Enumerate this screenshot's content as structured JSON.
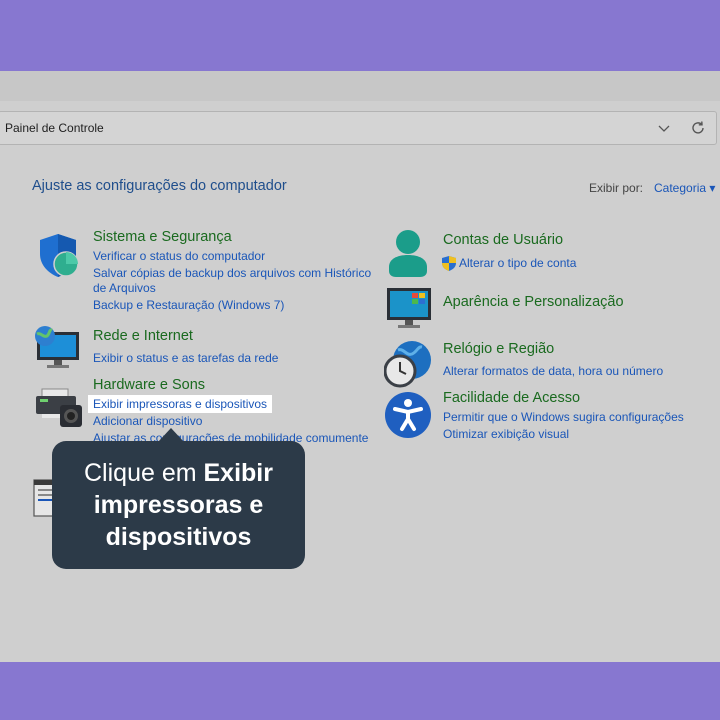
{
  "address": {
    "text": "Painel de Controle"
  },
  "heading": "Ajuste as configurações do computador",
  "view_by": {
    "label": "Exibir por:",
    "value": "Categoria"
  },
  "left_categories": [
    {
      "title": "Sistema e Segurança",
      "icon": "shield-icon",
      "links": [
        "Verificar o status do computador",
        "Salvar cópias de backup dos arquivos com Histórico",
        "de Arquivos",
        "Backup e Restauração (Windows 7)"
      ]
    },
    {
      "title": "Rede e Internet",
      "icon": "network-icon",
      "links": [
        "Exibir o status e as tarefas da rede"
      ]
    },
    {
      "title": "Hardware e Sons",
      "icon": "printer-icon",
      "links": [
        "Exibir impressoras e dispositivos",
        "Adicionar dispositivo",
        "Ajustar as configurações de mobilidade comumente"
      ]
    }
  ],
  "right_categories": [
    {
      "title": "Contas de Usuário",
      "icon": "user-icon",
      "links": [
        "Alterar o tipo de conta"
      ]
    },
    {
      "title": "Aparência e Personalização",
      "icon": "monitor-icon",
      "links": []
    },
    {
      "title": "Relógio e Região",
      "icon": "clock-globe-icon",
      "links": [
        "Alterar formatos de data, hora ou número"
      ]
    },
    {
      "title": "Facilidade de Acesso",
      "icon": "accessibility-icon",
      "links": [
        "Permitir que o Windows sugira configurações",
        "Otimizar exibição visual"
      ]
    }
  ],
  "tooltip": {
    "line1_prefix": "Clique em ",
    "line1_bold": "Exibir",
    "line2": "impressoras e",
    "line3": "dispositivos"
  },
  "colors": {
    "background": "#8777d0",
    "window": "#cfcfcf",
    "link": "#1a56b8",
    "category_title": "#1a6a1f",
    "tooltip": "#2c3a48"
  }
}
